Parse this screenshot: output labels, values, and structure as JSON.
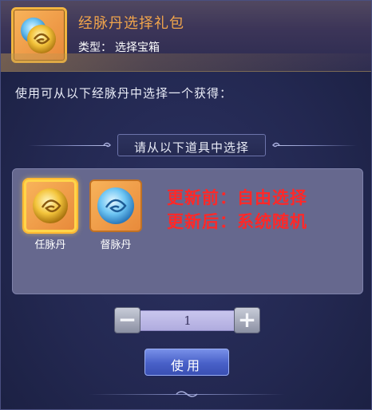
{
  "header": {
    "title": "经脉丹选择礼包",
    "type_label": "类型：",
    "type_value": "选择宝箱",
    "icon": "golden-swirl-orb-icon"
  },
  "description": "使用可从以下经脉丹中选择一个获得：",
  "section_title": "请从以下道具中选择",
  "items": [
    {
      "label": "任脉丹",
      "icon": "golden-swirl-orb-icon",
      "selected": true
    },
    {
      "label": "督脉丹",
      "icon": "blue-swirl-orb-icon",
      "selected": false
    }
  ],
  "note": {
    "line1": "更新前：自由选择",
    "line2": "更新后：系统随机"
  },
  "quantity": {
    "value": "1",
    "minus": "−",
    "plus": "+"
  },
  "use_button": "使用",
  "colors": {
    "title": "#f0a44b",
    "note": "#ff2828",
    "slot_orange": "#f8b35a",
    "button_blue": "#4860c8"
  }
}
